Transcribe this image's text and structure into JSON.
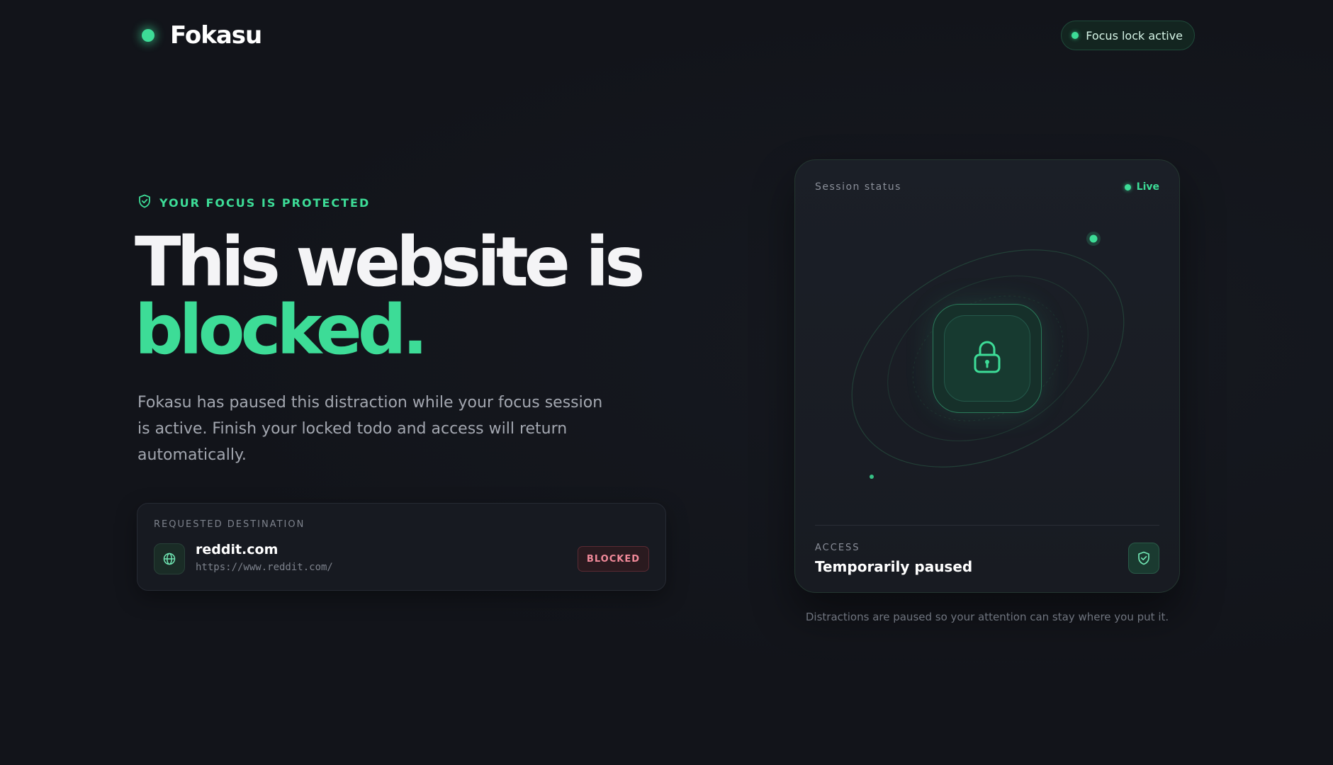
{
  "brand": {
    "name": "Fokasu",
    "accent_color": "#3ddc97"
  },
  "header": {
    "status_pill": "Focus lock active"
  },
  "hero": {
    "eyebrow": "YOUR FOCUS IS PROTECTED",
    "headline_line1": "This website is",
    "headline_accent": "blocked.",
    "description": "Fokasu has paused this distraction while your focus session is active. Finish your locked todo and access will return automatically."
  },
  "destination": {
    "label": "REQUESTED DESTINATION",
    "domain": "reddit.com",
    "url": "https://www.reddit.com/",
    "badge": "BLOCKED",
    "icon": "globe-icon"
  },
  "session": {
    "label": "Session status",
    "live": "Live",
    "center_icon": "lock-icon",
    "access_label": "ACCESS",
    "access_value": "Temporarily paused",
    "access_icon": "shield-check-icon"
  },
  "footnote": "Distractions are paused so your attention can stay where you put it."
}
